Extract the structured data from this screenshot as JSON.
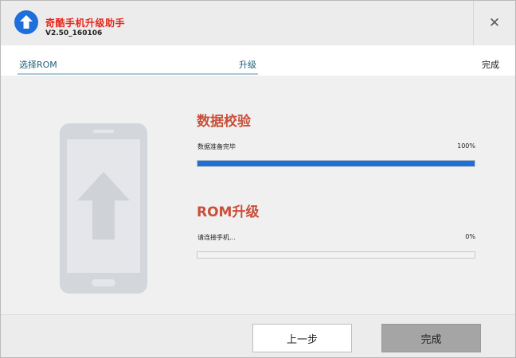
{
  "header": {
    "title": "奇酷手机升级助手",
    "version": "V2.50_160106",
    "close_label": "✕",
    "brand_color": "#1e6fd9",
    "title_color": "#e8261a"
  },
  "steps": [
    {
      "label": "选择ROM"
    },
    {
      "label": "升级"
    },
    {
      "label": "完成"
    }
  ],
  "sections": [
    {
      "title": "数据校验",
      "status_text": "数据准备完毕",
      "percent_label": "100%",
      "progress": 1.0
    },
    {
      "title": "ROM升级",
      "status_text": "请连接手机...",
      "percent_label": "0%",
      "progress": 0.0
    }
  ],
  "footer": {
    "prev_label": "上一步",
    "done_label": "完成"
  },
  "icons": {
    "app": "upload-arrow-icon",
    "close": "close-icon",
    "illustration": "phone-upgrade-icon"
  }
}
